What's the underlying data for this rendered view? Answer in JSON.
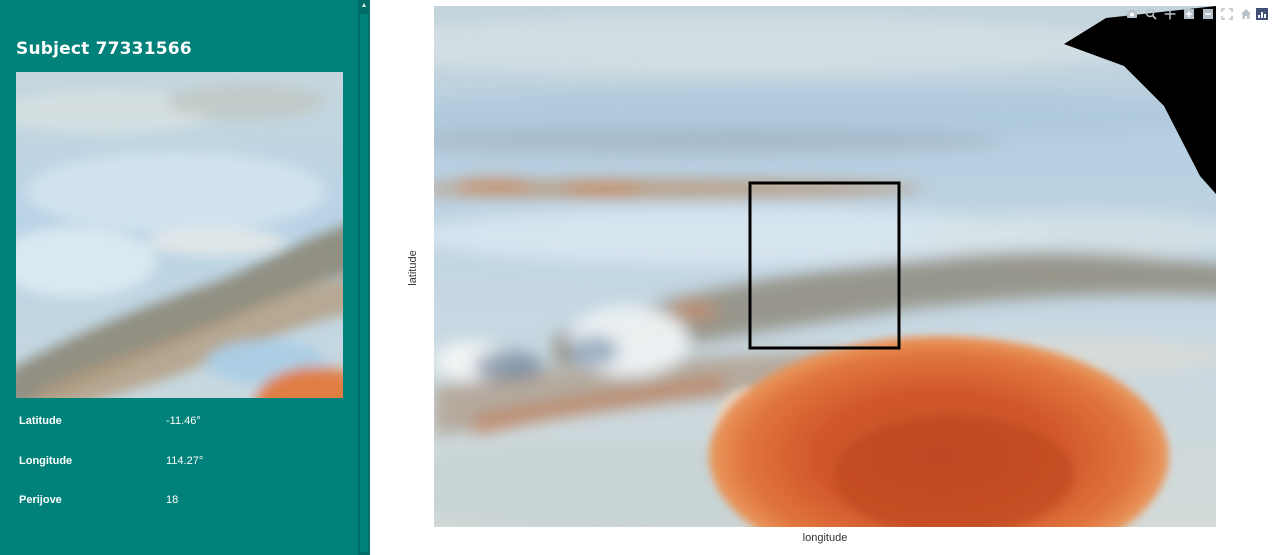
{
  "sidebar": {
    "title": "Subject 77331566",
    "details": [
      {
        "label": "Latitude",
        "value": "-11.46°"
      },
      {
        "label": "Longitude",
        "value": "114.27°"
      },
      {
        "label": "Perijove",
        "value": "18"
      }
    ]
  },
  "plot": {
    "xlabel": "longitude",
    "ylabel": "latitude"
  },
  "modebar": {
    "buttons": [
      "camera-icon",
      "zoom-icon",
      "pan-icon",
      "zoom-in-icon",
      "zoom-out-icon",
      "autoscale-icon",
      "home-icon"
    ]
  },
  "colors": {
    "sidebar_bg": "#00817a",
    "selection_box": "#000000",
    "great_red_spot": "#d2582c"
  }
}
